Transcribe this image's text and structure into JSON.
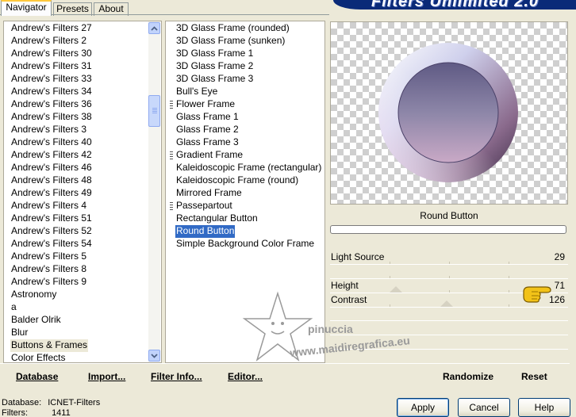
{
  "tabs": [
    {
      "label": "Navigator",
      "active": true
    },
    {
      "label": "Presets",
      "active": false
    },
    {
      "label": "About",
      "active": false
    }
  ],
  "banner": {
    "title": "Filters Unlimited 2.0"
  },
  "categories": {
    "items": [
      "Andrew's Filters 27",
      "Andrew's Filters 2",
      "Andrew's Filters 30",
      "Andrew's Filters 31",
      "Andrew's Filters 33",
      "Andrew's Filters 34",
      "Andrew's Filters 36",
      "Andrew's Filters 38",
      "Andrew's Filters 3",
      "Andrew's Filters 40",
      "Andrew's Filters 42",
      "Andrew's Filters 46",
      "Andrew's Filters 48",
      "Andrew's Filters 49",
      "Andrew's Filters 4",
      "Andrew's Filters 51",
      "Andrew's Filters 52",
      "Andrew's Filters 54",
      "Andrew's Filters 5",
      "Andrew's Filters 8",
      "Andrew's Filters 9",
      "Astronomy",
      "a",
      "Balder Olrik",
      "Blur",
      "Buttons & Frames",
      "Color Effects"
    ],
    "selected": "Buttons & Frames"
  },
  "filters": {
    "items": [
      {
        "label": "3D Glass Frame (rounded)",
        "grip": false
      },
      {
        "label": "3D Glass Frame (sunken)",
        "grip": false
      },
      {
        "label": "3D Glass Frame 1",
        "grip": false
      },
      {
        "label": "3D Glass Frame 2",
        "grip": false
      },
      {
        "label": "3D Glass Frame 3",
        "grip": false
      },
      {
        "label": "Bull's Eye",
        "grip": false
      },
      {
        "label": "Flower Frame",
        "grip": true
      },
      {
        "label": "Glass Frame 1",
        "grip": false
      },
      {
        "label": "Glass Frame 2",
        "grip": false
      },
      {
        "label": "Glass Frame 3",
        "grip": false
      },
      {
        "label": "Gradient Frame",
        "grip": true
      },
      {
        "label": "Kaleidoscopic Frame (rectangular)",
        "grip": false
      },
      {
        "label": "Kaleidoscopic Frame (round)",
        "grip": false
      },
      {
        "label": "Mirrored Frame",
        "grip": false
      },
      {
        "label": "Passepartout",
        "grip": true
      },
      {
        "label": "Rectangular Button",
        "grip": false
      },
      {
        "label": "Round Button",
        "grip": false
      },
      {
        "label": "Simple Background Color Frame",
        "grip": false
      }
    ],
    "selected": "Round Button"
  },
  "preview": {
    "filter_name": "Round Button"
  },
  "params": [
    {
      "label": "Light Source",
      "value": "29"
    },
    {
      "label": "Height",
      "value": "71"
    },
    {
      "label": "Contrast",
      "value": "126"
    }
  ],
  "watermark": {
    "line1": "pinuccia",
    "line2": "www.maidiregrafica.eu"
  },
  "actions": {
    "database": "Database",
    "import": "Import...",
    "filter_info": "Filter Info...",
    "editor": "Editor...",
    "randomize": "Randomize",
    "reset": "Reset"
  },
  "status": {
    "database_label": "Database:",
    "database_value": "ICNET-Filters",
    "filters_label": "Filters:",
    "filters_value": "1411"
  },
  "buttons": {
    "apply": "Apply",
    "cancel": "Cancel",
    "help": "Help"
  },
  "colors": {
    "selection": "#316ac5",
    "dialog_bg": "#ece9d8",
    "banner": "#0a2a78"
  }
}
